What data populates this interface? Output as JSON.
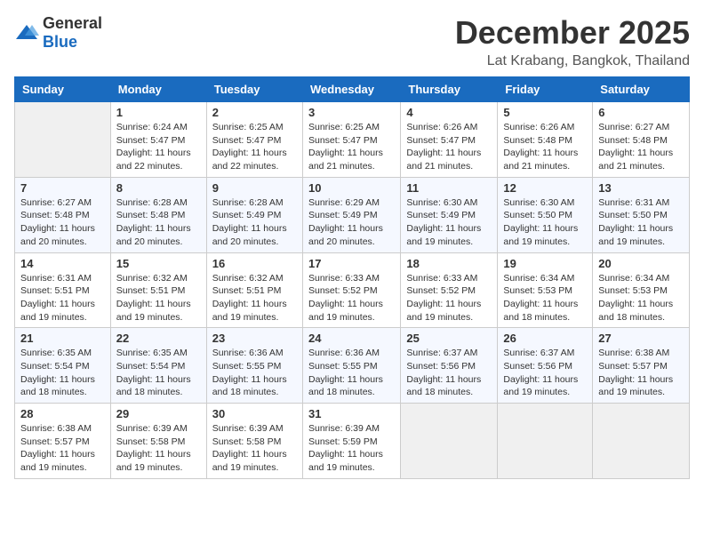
{
  "logo": {
    "general": "General",
    "blue": "Blue"
  },
  "title": "December 2025",
  "location": "Lat Krabang, Bangkok, Thailand",
  "days_of_week": [
    "Sunday",
    "Monday",
    "Tuesday",
    "Wednesday",
    "Thursday",
    "Friday",
    "Saturday"
  ],
  "weeks": [
    [
      {
        "day": "",
        "empty": true
      },
      {
        "day": "1",
        "sunrise": "Sunrise: 6:24 AM",
        "sunset": "Sunset: 5:47 PM",
        "daylight": "Daylight: 11 hours and 22 minutes."
      },
      {
        "day": "2",
        "sunrise": "Sunrise: 6:25 AM",
        "sunset": "Sunset: 5:47 PM",
        "daylight": "Daylight: 11 hours and 22 minutes."
      },
      {
        "day": "3",
        "sunrise": "Sunrise: 6:25 AM",
        "sunset": "Sunset: 5:47 PM",
        "daylight": "Daylight: 11 hours and 21 minutes."
      },
      {
        "day": "4",
        "sunrise": "Sunrise: 6:26 AM",
        "sunset": "Sunset: 5:47 PM",
        "daylight": "Daylight: 11 hours and 21 minutes."
      },
      {
        "day": "5",
        "sunrise": "Sunrise: 6:26 AM",
        "sunset": "Sunset: 5:48 PM",
        "daylight": "Daylight: 11 hours and 21 minutes."
      },
      {
        "day": "6",
        "sunrise": "Sunrise: 6:27 AM",
        "sunset": "Sunset: 5:48 PM",
        "daylight": "Daylight: 11 hours and 21 minutes."
      }
    ],
    [
      {
        "day": "7",
        "sunrise": "Sunrise: 6:27 AM",
        "sunset": "Sunset: 5:48 PM",
        "daylight": "Daylight: 11 hours and 20 minutes."
      },
      {
        "day": "8",
        "sunrise": "Sunrise: 6:28 AM",
        "sunset": "Sunset: 5:48 PM",
        "daylight": "Daylight: 11 hours and 20 minutes."
      },
      {
        "day": "9",
        "sunrise": "Sunrise: 6:28 AM",
        "sunset": "Sunset: 5:49 PM",
        "daylight": "Daylight: 11 hours and 20 minutes."
      },
      {
        "day": "10",
        "sunrise": "Sunrise: 6:29 AM",
        "sunset": "Sunset: 5:49 PM",
        "daylight": "Daylight: 11 hours and 20 minutes."
      },
      {
        "day": "11",
        "sunrise": "Sunrise: 6:30 AM",
        "sunset": "Sunset: 5:49 PM",
        "daylight": "Daylight: 11 hours and 19 minutes."
      },
      {
        "day": "12",
        "sunrise": "Sunrise: 6:30 AM",
        "sunset": "Sunset: 5:50 PM",
        "daylight": "Daylight: 11 hours and 19 minutes."
      },
      {
        "day": "13",
        "sunrise": "Sunrise: 6:31 AM",
        "sunset": "Sunset: 5:50 PM",
        "daylight": "Daylight: 11 hours and 19 minutes."
      }
    ],
    [
      {
        "day": "14",
        "sunrise": "Sunrise: 6:31 AM",
        "sunset": "Sunset: 5:51 PM",
        "daylight": "Daylight: 11 hours and 19 minutes."
      },
      {
        "day": "15",
        "sunrise": "Sunrise: 6:32 AM",
        "sunset": "Sunset: 5:51 PM",
        "daylight": "Daylight: 11 hours and 19 minutes."
      },
      {
        "day": "16",
        "sunrise": "Sunrise: 6:32 AM",
        "sunset": "Sunset: 5:51 PM",
        "daylight": "Daylight: 11 hours and 19 minutes."
      },
      {
        "day": "17",
        "sunrise": "Sunrise: 6:33 AM",
        "sunset": "Sunset: 5:52 PM",
        "daylight": "Daylight: 11 hours and 19 minutes."
      },
      {
        "day": "18",
        "sunrise": "Sunrise: 6:33 AM",
        "sunset": "Sunset: 5:52 PM",
        "daylight": "Daylight: 11 hours and 19 minutes."
      },
      {
        "day": "19",
        "sunrise": "Sunrise: 6:34 AM",
        "sunset": "Sunset: 5:53 PM",
        "daylight": "Daylight: 11 hours and 18 minutes."
      },
      {
        "day": "20",
        "sunrise": "Sunrise: 6:34 AM",
        "sunset": "Sunset: 5:53 PM",
        "daylight": "Daylight: 11 hours and 18 minutes."
      }
    ],
    [
      {
        "day": "21",
        "sunrise": "Sunrise: 6:35 AM",
        "sunset": "Sunset: 5:54 PM",
        "daylight": "Daylight: 11 hours and 18 minutes."
      },
      {
        "day": "22",
        "sunrise": "Sunrise: 6:35 AM",
        "sunset": "Sunset: 5:54 PM",
        "daylight": "Daylight: 11 hours and 18 minutes."
      },
      {
        "day": "23",
        "sunrise": "Sunrise: 6:36 AM",
        "sunset": "Sunset: 5:55 PM",
        "daylight": "Daylight: 11 hours and 18 minutes."
      },
      {
        "day": "24",
        "sunrise": "Sunrise: 6:36 AM",
        "sunset": "Sunset: 5:55 PM",
        "daylight": "Daylight: 11 hours and 18 minutes."
      },
      {
        "day": "25",
        "sunrise": "Sunrise: 6:37 AM",
        "sunset": "Sunset: 5:56 PM",
        "daylight": "Daylight: 11 hours and 18 minutes."
      },
      {
        "day": "26",
        "sunrise": "Sunrise: 6:37 AM",
        "sunset": "Sunset: 5:56 PM",
        "daylight": "Daylight: 11 hours and 19 minutes."
      },
      {
        "day": "27",
        "sunrise": "Sunrise: 6:38 AM",
        "sunset": "Sunset: 5:57 PM",
        "daylight": "Daylight: 11 hours and 19 minutes."
      }
    ],
    [
      {
        "day": "28",
        "sunrise": "Sunrise: 6:38 AM",
        "sunset": "Sunset: 5:57 PM",
        "daylight": "Daylight: 11 hours and 19 minutes."
      },
      {
        "day": "29",
        "sunrise": "Sunrise: 6:39 AM",
        "sunset": "Sunset: 5:58 PM",
        "daylight": "Daylight: 11 hours and 19 minutes."
      },
      {
        "day": "30",
        "sunrise": "Sunrise: 6:39 AM",
        "sunset": "Sunset: 5:58 PM",
        "daylight": "Daylight: 11 hours and 19 minutes."
      },
      {
        "day": "31",
        "sunrise": "Sunrise: 6:39 AM",
        "sunset": "Sunset: 5:59 PM",
        "daylight": "Daylight: 11 hours and 19 minutes."
      },
      {
        "day": "",
        "empty": true
      },
      {
        "day": "",
        "empty": true
      },
      {
        "day": "",
        "empty": true
      }
    ]
  ]
}
